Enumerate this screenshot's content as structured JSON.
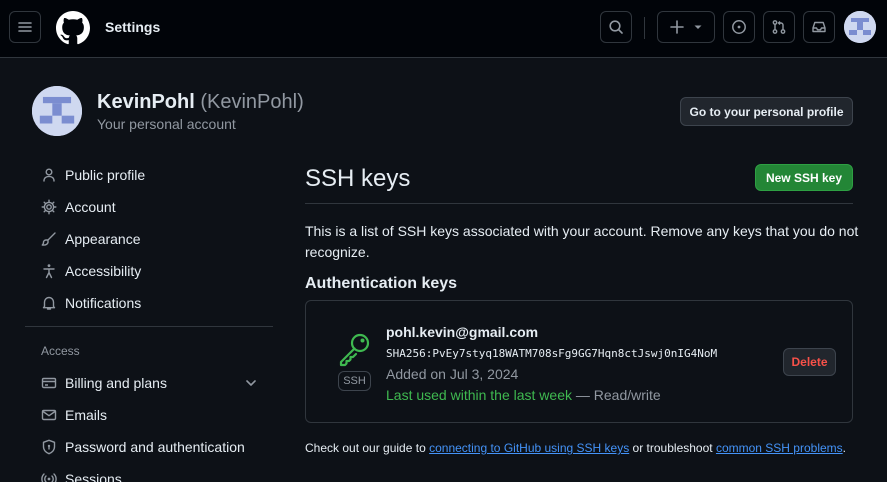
{
  "header": {
    "title": "Settings",
    "menu_icon": "hamburger-icon",
    "logo_icon": "github-octocat-icon",
    "search_icon": "search-icon",
    "create_icons": [
      "plus-icon",
      "triangle-down-icon"
    ],
    "issues_icon": "issue-opened-icon",
    "pulls_icon": "git-pull-request-icon",
    "inbox_icon": "inbox-icon"
  },
  "profile": {
    "name": "KevinPohl",
    "login": "(KevinPohl)",
    "subtitle": "Your personal account",
    "go_to_profile_label": "Go to your personal profile"
  },
  "sidebar": {
    "items": [
      {
        "label": "Public profile",
        "icon": "person-icon"
      },
      {
        "label": "Account",
        "icon": "gear-icon"
      },
      {
        "label": "Appearance",
        "icon": "paintbrush-icon"
      },
      {
        "label": "Accessibility",
        "icon": "accessibility-icon"
      },
      {
        "label": "Notifications",
        "icon": "bell-icon"
      }
    ],
    "access_heading": "Access",
    "access_items": [
      {
        "label": "Billing and plans",
        "icon": "credit-card-icon"
      },
      {
        "label": "Emails",
        "icon": "mail-icon"
      },
      {
        "label": "Password and authentication",
        "icon": "shield-lock-icon"
      },
      {
        "label": "Sessions",
        "icon": "broadcast-icon"
      }
    ]
  },
  "main": {
    "title": "SSH keys",
    "new_key_label": "New SSH key",
    "description": "This is a list of SSH keys associated with your account. Remove any keys that you do not recognize.",
    "section_heading": "Authentication keys",
    "keys": [
      {
        "title": "pohl.kevin@gmail.com",
        "type_label": "SSH",
        "fingerprint": "SHA256:PvEy7styq18WATM708sFg9GG7Hqn8ctJswj0nIG4NoM",
        "added": "Added on Jul 3, 2024",
        "last_used": "Last used within the last week",
        "access": "— Read/write",
        "delete_label": "Delete"
      }
    ],
    "footer": {
      "prefix": "Check out our guide to",
      "link1": "connecting to GitHub using SSH keys",
      "middle": "or troubleshoot",
      "link2": "common SSH problems",
      "suffix": "."
    }
  },
  "colors": {
    "background": "#0d1117",
    "header_bg": "#010409",
    "border": "#30363d",
    "primary_button": "#238636",
    "danger": "#f85149",
    "success": "#3fb950",
    "link": "#4493f8"
  }
}
